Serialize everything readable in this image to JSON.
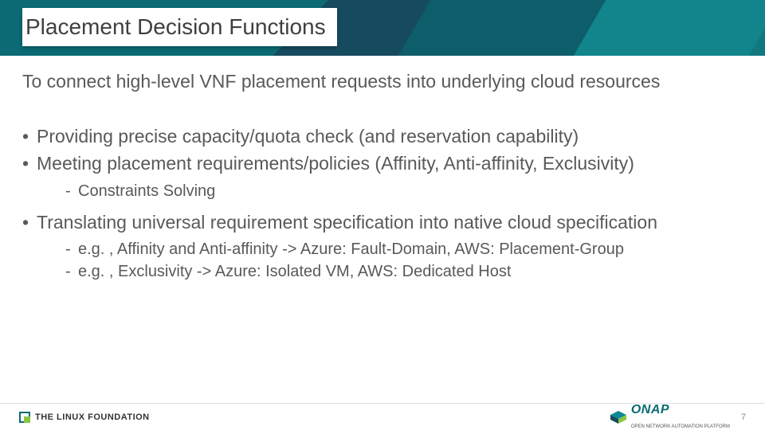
{
  "title": "Placement Decision Functions",
  "intro": "To connect high-level VNF placement requests into underlying cloud resources",
  "bullets": {
    "b1": "Providing precise capacity/quota check (and reservation capability)",
    "b2": "Meeting placement requirements/policies (Affinity, Anti-affinity, Exclusivity)",
    "b2_sub1": "Constraints Solving",
    "b3": "Translating universal requirement specification into native cloud specification",
    "b3_sub1": "e.g. , Affinity and Anti-affinity -> Azure: Fault-Domain, AWS: Placement-Group",
    "b3_sub2": "e.g. , Exclusivity -> Azure: Isolated VM, AWS: Dedicated Host"
  },
  "footer": {
    "linux_foundation": "THE LINUX FOUNDATION",
    "onap": "ONAP",
    "onap_tag": "OPEN NETWORK AUTOMATION PLATFORM",
    "page": "7"
  }
}
